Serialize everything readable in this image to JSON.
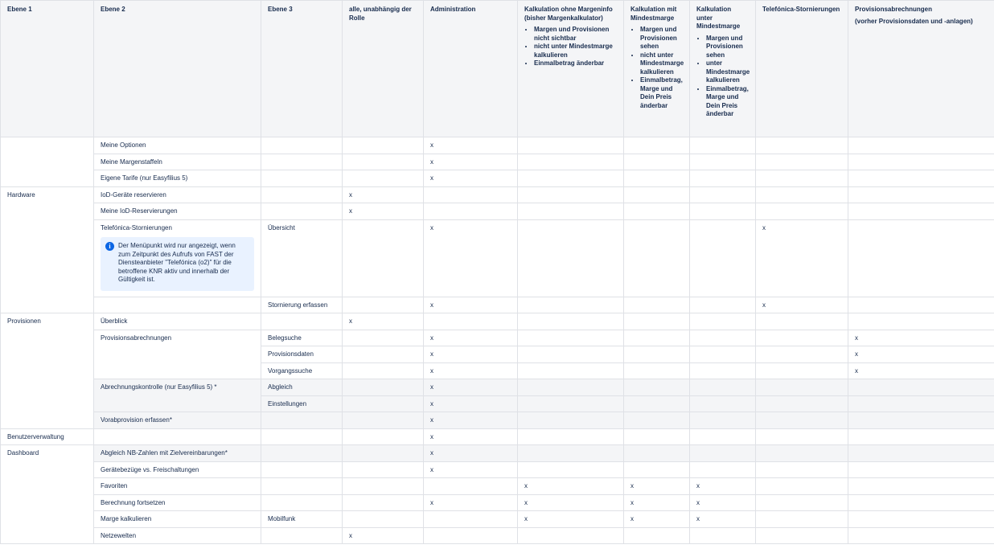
{
  "headers": {
    "ebene1": "Ebene 1",
    "ebene2": "Ebene 2",
    "ebene3": "Ebene 3",
    "alle": "alle, unabhängig der Rolle",
    "admin": "Administration",
    "kalk_ohne": "Kalkulation ohne Margeninfo (bisher Margenkalkulator)",
    "kalk_ohne_items": [
      "Margen und Provisionen nicht sichtbar",
      "nicht unter Mindestmarge kalkulieren",
      "Einmalbetrag änderbar"
    ],
    "kalk_mit": "Kalkulation mit Mindestmarge",
    "kalk_mit_items": [
      "Margen und Provisionen sehen",
      "nicht unter Mindestmarge kalkulieren",
      "Einmalbetrag, Marge und Dein Preis änderbar"
    ],
    "kalk_unter": "Kalkulation unter Mindestmarge",
    "kalk_unter_items": [
      "Margen und Provisionen sehen",
      "unter Mindestmarge kalkulieren",
      "Einmalbetrag, Marge und Dein Preis änderbar"
    ],
    "storno": "Telefónica-Stornierungen",
    "prov": "Provisionsabrechnungen",
    "prov_sub": "(vorher Provisionsdaten und -anlagen)"
  },
  "mark": "x",
  "note": "Der Menüpunkt wird nur angezeigt, wenn zum Zeitpunkt des Aufrufs von FAST der Diensteanbieter \"Telefónica (o2)\" für die betroffene KNR aktiv und innerhalb der Gültigkeit ist.",
  "rows": {
    "meine_optionen": "Meine Optionen",
    "meine_margenstaffeln": "Meine Margenstaffeln",
    "eigene_tarife": "Eigene Tarife (nur Easyfilius 5)",
    "hardware": "Hardware",
    "iod_reservieren": "IoD-Geräte reservieren",
    "meine_iod": "Meine IoD-Reservierungen",
    "telefonica_storno": "Telefónica-Stornierungen",
    "uebersicht": "Übersicht",
    "stornierung_erfassen": "Stornierung erfassen",
    "provisionen": "Provisionen",
    "ueberblick": "Überblick",
    "provisionsabrechnungen": "Provisionsabrechnungen",
    "belegsuche": "Belegsuche",
    "provisionsdaten": "Provisionsdaten",
    "vorgangssuche": "Vorgangssuche",
    "abrechnungskontrolle": "Abrechnungskontrolle (nur Easyfilius 5) *",
    "abgleich": "Abgleich",
    "einstellungen": "Einstellungen",
    "vorabprovision": "Vorabprovision erfassen*",
    "benutzerverwaltung": "Benutzerverwaltung",
    "dashboard": "Dashboard",
    "abgleich_nb": "Abgleich NB-Zahlen mit Zielvereinbarungen*",
    "geraetebezuege": "Gerätebezüge vs. Freischaltungen",
    "favoriten": "Favoriten",
    "berechnung": "Berechnung fortsetzen",
    "marge_kalkulieren": "Marge kalkulieren",
    "mobilfunk": "Mobilfunk",
    "netzewelten": "Netzewelten"
  }
}
